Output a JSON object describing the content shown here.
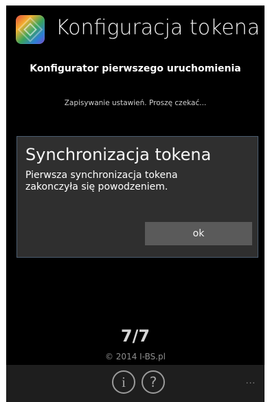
{
  "app": {
    "title": "Konfiguracja tokena",
    "icon": "app-cube-icon"
  },
  "wizard": {
    "title": "Konfigurator pierwszego uruchomienia",
    "status": "Zapisywanie ustawień. Proszę czekać...",
    "step": "7/7",
    "copyright": "© 2014 I-BS.pl"
  },
  "dialog": {
    "title": "Synchronizacja tokena",
    "message": "Pierwsza synchronizacja tokena zakonczyła się powodzeniem.",
    "ok_label": "ok"
  },
  "app_bar": {
    "icons": [
      "info-icon",
      "help-icon",
      "more-icon"
    ],
    "info_glyph": "i",
    "help_glyph": "?",
    "more_glyph": "..."
  },
  "colors": {
    "background": "#000000",
    "dialog": "#2f2f2f",
    "dialog_border": "#4a5c70",
    "button": "#5a5a5a",
    "app_bar": "#1e1e1e"
  }
}
